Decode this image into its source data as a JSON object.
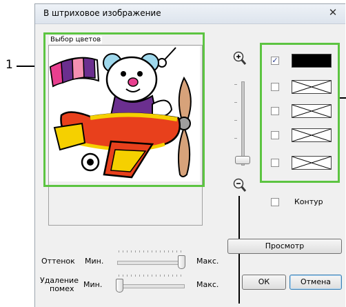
{
  "dialog": {
    "title": "В штриховое изображение",
    "close_glyph": "✕"
  },
  "preview": {
    "label": "Выбор цветов"
  },
  "callouts": {
    "left_number": "1"
  },
  "zoom": {
    "in_icon": "zoom-in-icon",
    "out_icon": "zoom-out-icon"
  },
  "colors": {
    "rows": [
      {
        "checked": true,
        "swatch": "#000000"
      },
      {
        "checked": false,
        "swatch": "none"
      },
      {
        "checked": false,
        "swatch": "none"
      },
      {
        "checked": false,
        "swatch": "none"
      },
      {
        "checked": false,
        "swatch": "none"
      }
    ],
    "outline_label": "Контур",
    "check_glyph": "✓"
  },
  "hue": {
    "label": "Оттенок",
    "min_label": "Мин.",
    "max_label": "Макс.",
    "level": 1.0
  },
  "noise": {
    "label_line1": "Удаление",
    "label_line2": "помех",
    "min_label": "Мин.",
    "max_label": "Макс.",
    "level": 0.0
  },
  "buttons": {
    "preview": "Просмотр",
    "ok": "ОК",
    "cancel": "Отмена"
  },
  "accent": {
    "annotation_green": "#5cc441"
  }
}
